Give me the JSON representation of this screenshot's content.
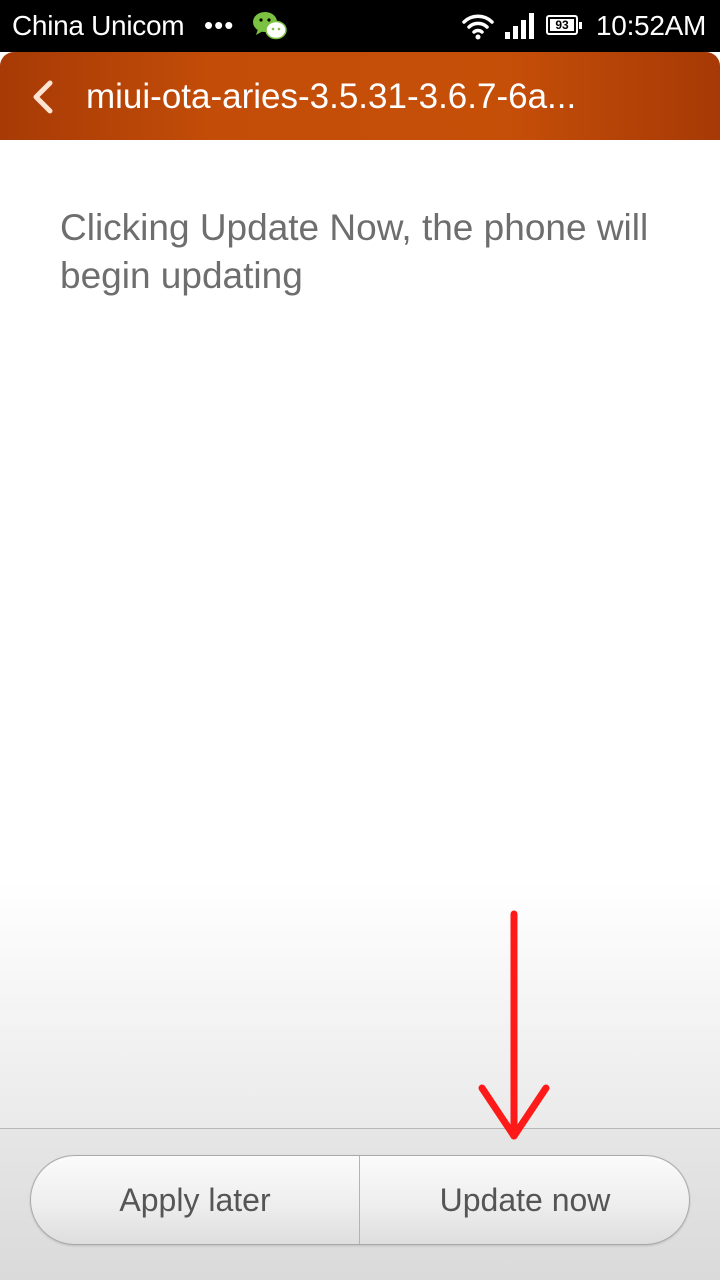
{
  "status_bar": {
    "carrier": "China Unicom",
    "more": "•••",
    "battery_level": "93",
    "time": "10:52AM",
    "icons": [
      "wechat-icon",
      "wifi-icon",
      "signal-icon",
      "battery-icon"
    ]
  },
  "title_bar": {
    "back_icon": "chevron-left-icon",
    "title": "miui-ota-aries-3.5.31-3.6.7-6a..."
  },
  "content": {
    "message": "Clicking Update Now, the phone will begin updating"
  },
  "actions": {
    "apply_later": "Apply later",
    "update_now": "Update now"
  },
  "colors": {
    "title_bar": "#c34d08",
    "annotation_arrow": "#ff1a1a"
  }
}
